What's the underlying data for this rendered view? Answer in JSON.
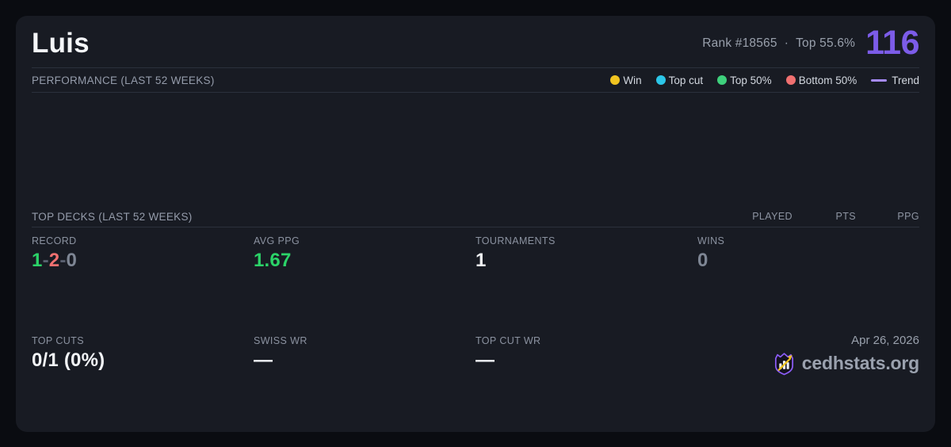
{
  "header": {
    "player_name": "Luis",
    "rank": "Rank #18565",
    "dot_separator": "·",
    "top_percent": "Top 55.6%",
    "score": "116"
  },
  "performance": {
    "section_title": "PERFORMANCE (LAST 52 WEEKS)",
    "chart_empty": true,
    "legend": [
      {
        "label": "Win",
        "color": "#f0c420",
        "marker": "dot"
      },
      {
        "label": "Top cut",
        "color": "#2cc6e8",
        "marker": "dot"
      },
      {
        "label": "Top 50%",
        "color": "#3ed07c",
        "marker": "dot"
      },
      {
        "label": "Bottom 50%",
        "color": "#f07070",
        "marker": "dot"
      },
      {
        "label": "Trend",
        "color": "#a78bfa",
        "marker": "line"
      }
    ]
  },
  "top_decks": {
    "section_title": "TOP DECKS (LAST 52 WEEKS)",
    "columns": [
      "PLAYED",
      "PTS",
      "PPG"
    ],
    "rows": []
  },
  "stats": {
    "record": {
      "label": "RECORD",
      "wins": "1",
      "separator": "-",
      "losses": "2",
      "draws": "0"
    },
    "avg_ppg": {
      "label": "AVG PPG",
      "value": "1.67"
    },
    "tournaments": {
      "label": "TOURNAMENTS",
      "value": "1"
    },
    "wins": {
      "label": "WINS",
      "value": "0"
    },
    "top_cuts": {
      "label": "TOP CUTS",
      "value": "0/1 (0%)"
    },
    "swiss_wr": {
      "label": "SWISS WR",
      "value": "—"
    },
    "top_cut_wr": {
      "label": "TOP CUT WR",
      "value": "—"
    }
  },
  "footer": {
    "date": "Apr 26, 2026",
    "brand": "cedhstats.org"
  },
  "colors": {
    "accent_purple": "#7c5ce8",
    "trend_purple": "#a78bfa",
    "win_green": "#2bd368",
    "loss_red": "#f07070",
    "muted_gray": "#7e8694",
    "card_background": "#181b23",
    "page_background": "#0a0c11"
  }
}
